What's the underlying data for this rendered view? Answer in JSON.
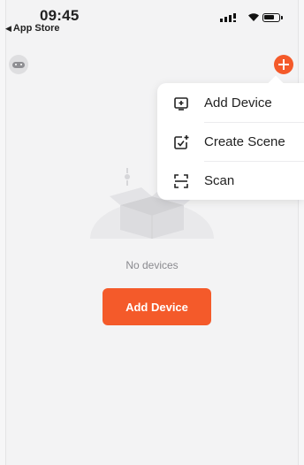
{
  "status_bar": {
    "time": "09:45",
    "back_app": "App Store"
  },
  "empty_state": {
    "message": "No devices",
    "add_button": "Add Device"
  },
  "menu": {
    "items": [
      {
        "label": "Add Device",
        "icon": "add-device-icon"
      },
      {
        "label": "Create Scene",
        "icon": "create-scene-icon"
      },
      {
        "label": "Scan",
        "icon": "scan-icon"
      }
    ]
  },
  "colors": {
    "accent": "#f45a2a",
    "background": "#f3f3f4",
    "menu_bg": "#ffffff"
  }
}
